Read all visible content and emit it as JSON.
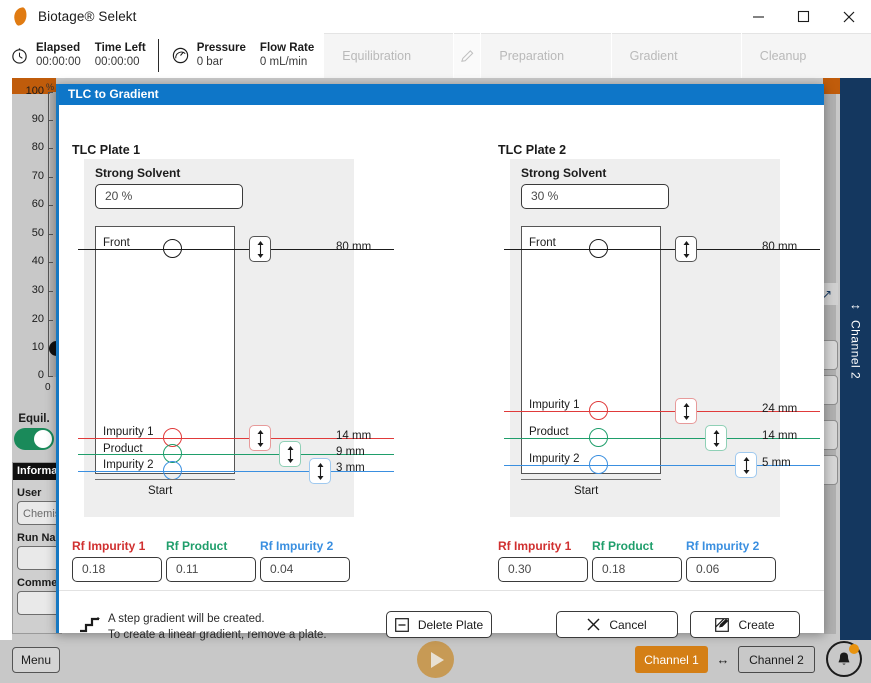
{
  "window": {
    "title": "Biotage® Selekt",
    "minimize_label": "Minimize",
    "maximize_label": "Maximize",
    "close_label": "Close"
  },
  "status": {
    "timer_icon": "stopwatch-icon",
    "pressure_icon": "gauge-icon",
    "metrics": [
      {
        "label": "Elapsed",
        "value": "00:00:00"
      },
      {
        "label": "Time Left",
        "value": "00:00:00"
      },
      {
        "label": "Pressure",
        "value": "0 bar"
      },
      {
        "label": "Flow Rate",
        "value": "0 mL/min"
      }
    ]
  },
  "stages": [
    {
      "label": "Equilibration"
    },
    {
      "label": "Preparation"
    },
    {
      "label": "Gradient"
    },
    {
      "label": "Cleanup"
    }
  ],
  "background": {
    "axis": {
      "unit": "%",
      "ticks": [
        "100",
        "90",
        "80",
        "70",
        "60",
        "50",
        "40",
        "30",
        "20",
        "10",
        "0"
      ],
      "knob_value": "10",
      "x_zero": "0"
    },
    "equilibration_label": "Equil.",
    "information_panel": {
      "header": "Information",
      "fields": [
        {
          "label": "User",
          "value": "Chemist"
        },
        {
          "label": "Run Name",
          "value": ""
        },
        {
          "label": "Comment",
          "value": ""
        }
      ]
    },
    "channel_side_label": "Channel 2"
  },
  "bottom_bar": {
    "menu_label": "Menu",
    "play_label": "Run",
    "channel_1_label": "Channel 1",
    "channel_2_label": "Channel 2",
    "swap_icon": "left-right-arrow-icon",
    "bell_icon": "bell-icon"
  },
  "dialog": {
    "title": "TLC to Gradient",
    "plates": [
      {
        "title": "TLC Plate 1",
        "strong_solvent_label": "Strong Solvent",
        "strong_solvent_value": "20 %",
        "front_label": "Front",
        "start_label": "Start",
        "front_mm": "80 mm",
        "bands": [
          {
            "name": "Impurity 1",
            "mm": "14 mm",
            "color": "#e03a3a"
          },
          {
            "name": "Product",
            "mm": "9 mm",
            "color": "#1f9e6b"
          },
          {
            "name": "Impurity 2",
            "mm": "3 mm",
            "color": "#3a8fe0"
          }
        ],
        "rf_fields": [
          {
            "label": "Rf Impurity 1",
            "value": "0.18",
            "color": "#d03030"
          },
          {
            "label": "Rf Product",
            "value": "0.11",
            "color": "#1f9e6b"
          },
          {
            "label": "Rf Impurity 2",
            "value": "0.04",
            "color": "#3a8fe0"
          }
        ]
      },
      {
        "title": "TLC Plate 2",
        "strong_solvent_label": "Strong Solvent",
        "strong_solvent_value": "30 %",
        "front_label": "Front",
        "start_label": "Start",
        "front_mm": "80 mm",
        "bands": [
          {
            "name": "Impurity 1",
            "mm": "24 mm",
            "color": "#e03a3a"
          },
          {
            "name": "Product",
            "mm": "14 mm",
            "color": "#1f9e6b"
          },
          {
            "name": "Impurity 2",
            "mm": "5 mm",
            "color": "#3a8fe0"
          }
        ],
        "rf_fields": [
          {
            "label": "Rf Impurity 1",
            "value": "0.30",
            "color": "#d03030"
          },
          {
            "label": "Rf Product",
            "value": "0.18",
            "color": "#1f9e6b"
          },
          {
            "label": "Rf Impurity 2",
            "value": "0.06",
            "color": "#3a8fe0"
          }
        ]
      }
    ],
    "note": {
      "icon": "step-gradient-icon",
      "line1": "A step gradient will be created.",
      "line2": "To create a linear gradient, remove a plate."
    },
    "buttons": {
      "delete_plate": "Delete Plate",
      "cancel": "Cancel",
      "create": "Create"
    }
  }
}
